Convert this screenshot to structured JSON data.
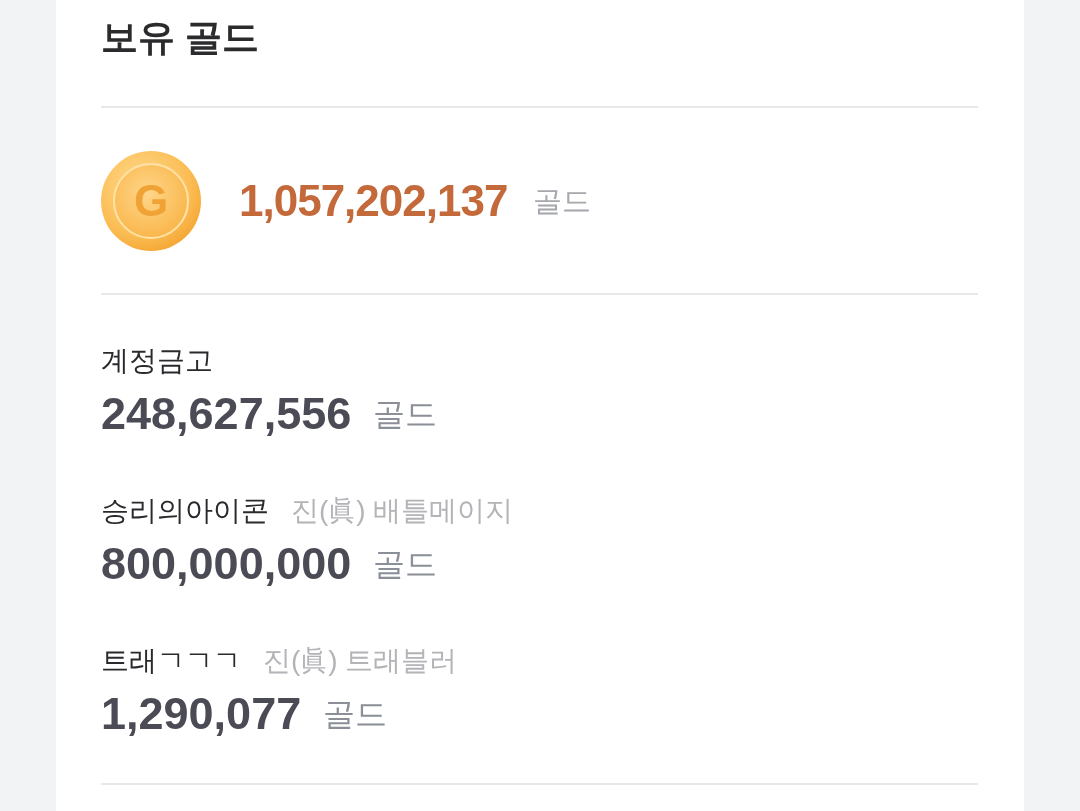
{
  "title": "보유 골드",
  "total": {
    "coin_letter": "G",
    "amount": "1,057,202,137",
    "unit": "골드"
  },
  "accounts": [
    {
      "name": "계정금고",
      "amount": "248,627,556",
      "unit": "골드"
    },
    {
      "name": "승리의아이콘",
      "job": "진(眞) 배틀메이지",
      "amount": "800,000,000",
      "unit": "골드"
    },
    {
      "name": "트래ㄱㄱㄱ",
      "job": "진(眞) 트래블러",
      "amount": "1,290,077",
      "unit": "골드"
    }
  ]
}
